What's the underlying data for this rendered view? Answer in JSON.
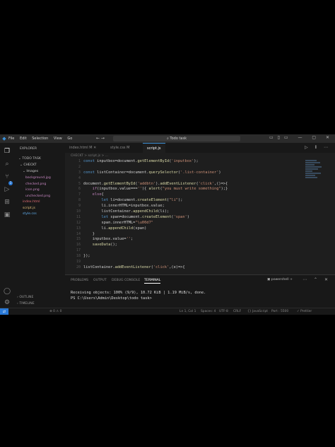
{
  "window_title": "Todo task",
  "menu": [
    "File",
    "Edit",
    "Selection",
    "View",
    "Go"
  ],
  "sidebar": {
    "header": "EXPLORER",
    "project": "TODO TASK",
    "folder": "CHECKT",
    "subfolder": "Images",
    "files": [
      {
        "name": "background.jpg",
        "color": "#c586c0"
      },
      {
        "name": "checked.png",
        "color": "#c586c0"
      },
      {
        "name": "icon.png",
        "color": "#c586c0"
      },
      {
        "name": "unchecked.png",
        "color": "#c586c0"
      },
      {
        "name": "index.html",
        "color": "#e06c75"
      },
      {
        "name": "script.js",
        "color": "#e5c07b"
      },
      {
        "name": "style.css",
        "color": "#61afef"
      }
    ],
    "outline": "OUTLINE",
    "timeline": "TIMELINE"
  },
  "tabs": [
    {
      "label": "index.html M"
    },
    {
      "label": "style.css M"
    },
    {
      "label": "script.js"
    }
  ],
  "breadcrumb": "CHECKT > script.js > ...",
  "code_lines": [
    "const inputbox=document.getElementById('inputbox');",
    "",
    "const listContainer=document.querySelector('.list-container')",
    "",
    "document.getElementById('addbtn').addEventListener('click',()=>{",
    "    if(inputbox.value===''){ alert(\"you must write something\");}",
    "    else{",
    "        let li=document.createElement(\"li\");",
    "        li.innerHTML=inputbox.value;",
    "        listContainer.appendChild(li);",
    "        let span=document.createElement('span')",
    "        span.innerHTML=\"\\u00d7\"",
    "        li.appendChild(span)",
    "    }",
    "    inputbox.value='';",
    "    saveData();",
    "",
    "});",
    "",
    "listContainer.addEventListener('click',(e)=>{"
  ],
  "line_numbers": [
    "1",
    "2",
    "3",
    "4",
    "5",
    "6",
    "7",
    "8",
    "9",
    "10",
    "11",
    "12",
    "13",
    "14",
    "15",
    "16",
    "17",
    "18",
    "19",
    "20"
  ],
  "panel": {
    "tabs": [
      "PROBLEMS",
      "OUTPUT",
      "DEBUG CONSOLE",
      "TERMINAL"
    ],
    "shell": "powershell",
    "terminal_lines": [
      "Receiving objects: 100% (9/9), 10.72 KiB | 1.19 MiB/s, done.",
      "PS C:\\Users\\Admin\\Desktop\\todo task>"
    ]
  },
  "status": {
    "left": "⊗ 0 ⚠ 0",
    "position": "Ln 1, Col 1",
    "spaces": "Spaces: 4",
    "encoding": "UTF-8",
    "eol": "CRLF",
    "language": "{} JavaScript",
    "port": "Port : 5500",
    "prettier": "✓ Prettier"
  }
}
